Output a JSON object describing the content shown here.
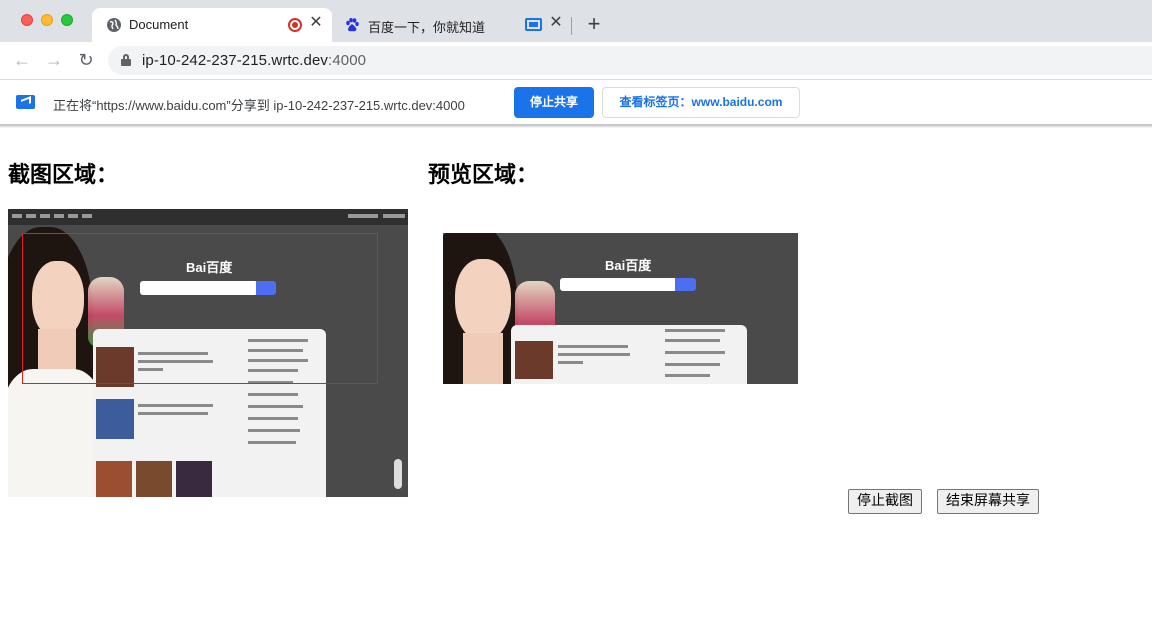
{
  "browser": {
    "tabs": [
      {
        "title": "Document",
        "active": true,
        "recording": true
      },
      {
        "title": "百度一下，你就知道",
        "active": false,
        "casting": true
      }
    ],
    "new_tab_symbol": "+",
    "close_symbol": "✕",
    "url_host": "ip-10-242-237-215.wrtc.dev",
    "url_port": ":4000",
    "icons": [
      "back-arrow-icon",
      "forward-arrow-icon",
      "reload-icon",
      "lock-icon",
      "globe-icon",
      "baidu-paw-icon",
      "cast-icon",
      "record-icon"
    ]
  },
  "infobar": {
    "message": "正在将“https://www.baidu.com”分享到 ip-10-242-237-215.wrtc.dev:4000",
    "stop_share_label": "停止共享",
    "view_tab_label": "查看标签页：www.baidu.com",
    "accent": "#1a73e8"
  },
  "page": {
    "capture_heading": "截图区域：",
    "preview_heading": "预览区域：",
    "stop_capture_label": "停止截图",
    "end_screen_share_label": "结束屏幕共享"
  },
  "screenshot": {
    "logo_text": "Bai百度"
  }
}
